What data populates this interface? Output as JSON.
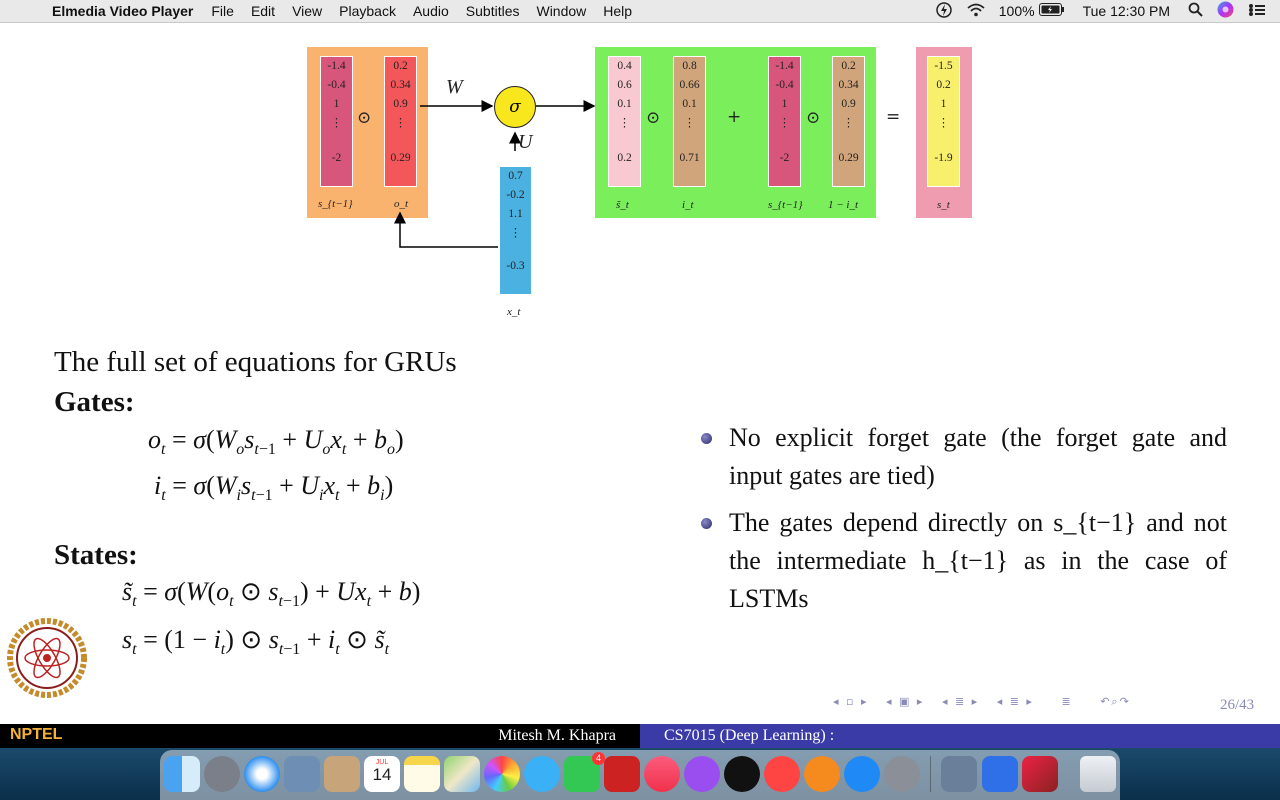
{
  "menubar": {
    "app_name": "Elmedia Video Player",
    "items": [
      "File",
      "Edit",
      "View",
      "Playback",
      "Audio",
      "Subtitles",
      "Window",
      "Help"
    ],
    "battery": "100%",
    "clock": "Tue 12:30 PM"
  },
  "diagram": {
    "s_prev": [
      "-1.4",
      "-0.4",
      "1",
      "-2"
    ],
    "o_t": [
      "0.2",
      "0.34",
      "0.9",
      "0.29"
    ],
    "x_t": [
      "0.7",
      "-0.2",
      "1.1",
      "-0.3"
    ],
    "s_tilde": [
      "0.4",
      "0.6",
      "0.1",
      "0.2"
    ],
    "i_t": [
      "0.8",
      "0.66",
      "0.1",
      "0.71"
    ],
    "s_prev2": [
      "-1.4",
      "-0.4",
      "1",
      "-2"
    ],
    "one_minus_i": [
      "0.2",
      "0.34",
      "0.9",
      "0.29"
    ],
    "s_t": [
      "-1.5",
      "0.2",
      "1",
      "-1.9"
    ],
    "labels": {
      "s_prev": "s_{t−1}",
      "o_t": "o_t",
      "x_t": "x_t",
      "s_tilde": "s̃_t",
      "i_t": "i_t",
      "s_prev2": "s_{t−1}",
      "one_minus_i": "1 − i_t",
      "s_t": "s_t",
      "W": "W",
      "U": "U",
      "sigma": "σ"
    },
    "ops": {
      "odot": "⊙",
      "plus": "+",
      "equals": "="
    }
  },
  "slide": {
    "heading": "The full set of equations for GRUs",
    "gates_heading": "Gates:",
    "states_heading": "States:",
    "bullets": [
      "No explicit forget gate (the forget gate and input gates are tied)",
      "The gates depend directly on s_{t−1} and not the intermediate h_{t−1} as in the case of LSTMs"
    ],
    "page": "26/43"
  },
  "footer": {
    "logo_text": "NPTEL",
    "author": "Mitesh M. Khapra",
    "course": "CS7015 (Deep Learning) :"
  },
  "dock": {
    "calendar_month": "JUL",
    "calendar_day": "14",
    "facetime_badge": "4"
  },
  "colors": {
    "orange_box": "#f9b36e",
    "green_box": "#7bef5b",
    "pink_box": "#f7a4b3",
    "blue_vec": "#4bb1e0",
    "footer_black": "#000000",
    "footer_blue": "#3b3ba8"
  }
}
